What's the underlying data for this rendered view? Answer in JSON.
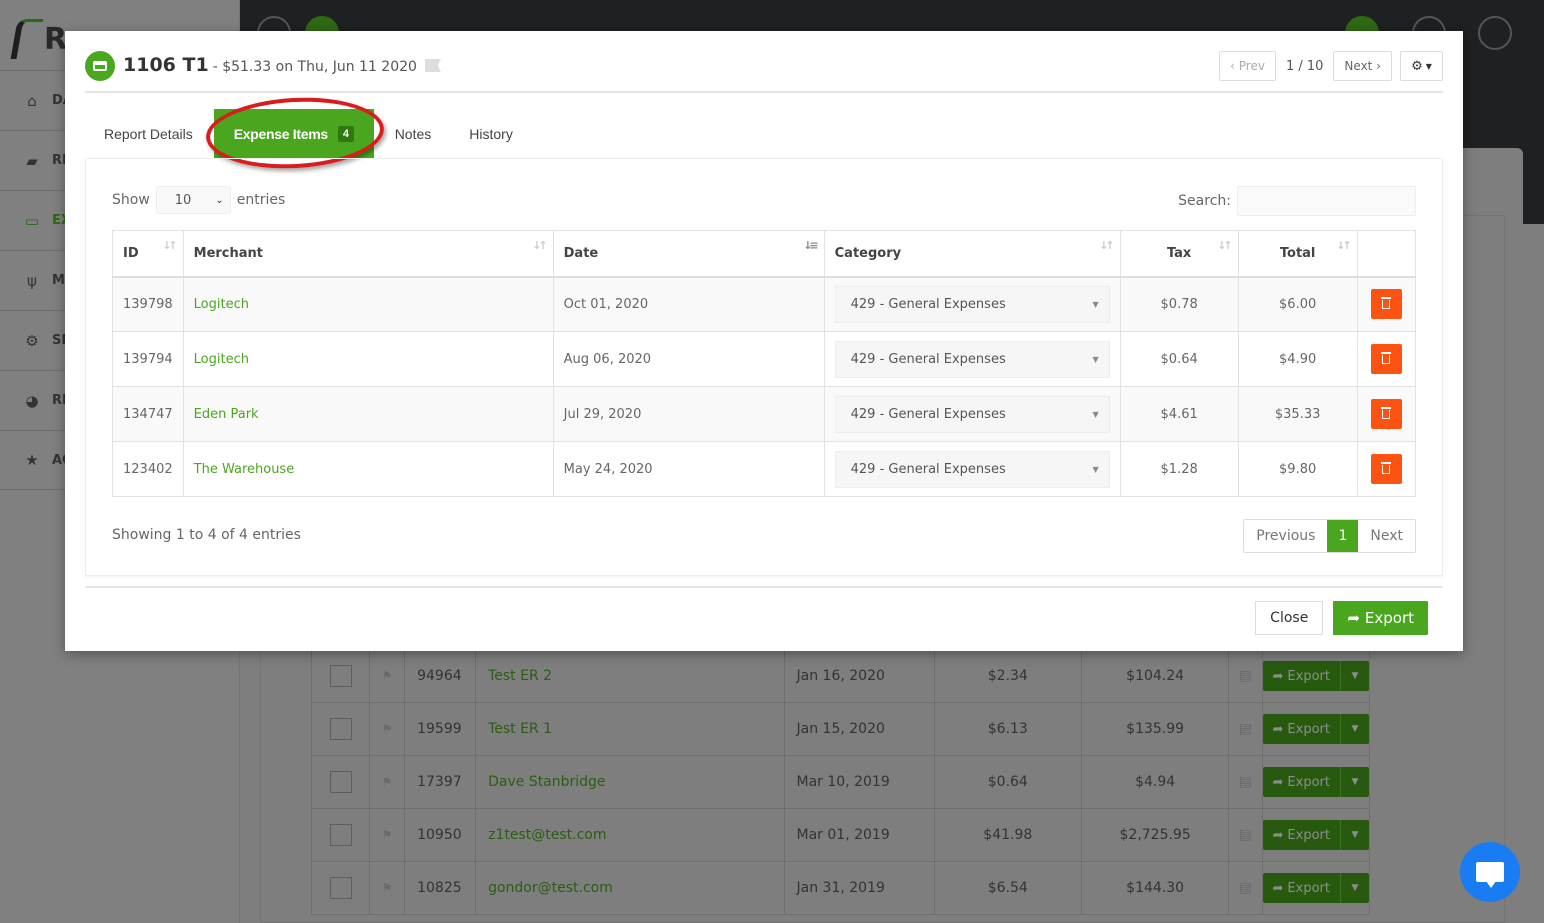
{
  "background": {
    "logo_text": "Re",
    "nav": [
      {
        "label": "DA",
        "icon": "home-icon",
        "glyph": "⌂"
      },
      {
        "label": "RE",
        "icon": "receipt-icon",
        "glyph": "▰"
      },
      {
        "label": "EX",
        "icon": "credit-card-icon",
        "glyph": "▭",
        "active": true
      },
      {
        "label": "MI",
        "icon": "utensils-icon",
        "glyph": "ψ"
      },
      {
        "label": "SE",
        "icon": "gear-icon",
        "glyph": "⚙"
      },
      {
        "label": "RE",
        "icon": "pie-chart-icon",
        "glyph": "◕"
      },
      {
        "label": "AC",
        "icon": "star-icon",
        "glyph": "★"
      }
    ],
    "rows": [
      {
        "id": "94964",
        "name": "Test ER 2",
        "date": "Jan 16, 2020",
        "tax": "$2.34",
        "total": "$104.24",
        "export": "Export"
      },
      {
        "id": "19599",
        "name": "Test ER 1",
        "date": "Jan 15, 2020",
        "tax": "$6.13",
        "total": "$135.99",
        "export": "Export"
      },
      {
        "id": "17397",
        "name": "Dave Stanbridge",
        "date": "Mar 10, 2019",
        "tax": "$0.64",
        "total": "$4.94",
        "export": "Export"
      },
      {
        "id": "10950",
        "name": "z1test@test.com",
        "date": "Mar 01, 2019",
        "tax": "$41.98",
        "total": "$2,725.95",
        "export": "Export"
      },
      {
        "id": "10825",
        "name": "gondor@test.com",
        "date": "Jan 31, 2019",
        "tax": "$6.54",
        "total": "$144.30",
        "export": "Export"
      }
    ]
  },
  "modal": {
    "title": "1106 T1",
    "subtitle": "- $51.33 on Thu, Jun 11 2020",
    "prev_label": "‹ Prev",
    "pager": "1 / 10",
    "next_label": "Next ›",
    "tabs": [
      {
        "label": "Report Details"
      },
      {
        "label": "Expense Items",
        "badge": "4",
        "active": true
      },
      {
        "label": "Notes"
      },
      {
        "label": "History"
      }
    ],
    "length": {
      "show": "Show",
      "value": "10",
      "entries": "entries"
    },
    "search": {
      "label": "Search:",
      "value": ""
    },
    "columns": [
      "ID",
      "Merchant",
      "Date",
      "Category",
      "Tax",
      "Total"
    ],
    "items": [
      {
        "id": "139798",
        "merchant": "Logitech",
        "date": "Oct 01, 2020",
        "category": "429 - General Expenses",
        "tax": "$0.78",
        "total": "$6.00"
      },
      {
        "id": "139794",
        "merchant": "Logitech",
        "date": "Aug 06, 2020",
        "category": "429 - General Expenses",
        "tax": "$0.64",
        "total": "$4.90"
      },
      {
        "id": "134747",
        "merchant": "Eden Park",
        "date": "Jul 29, 2020",
        "category": "429 - General Expenses",
        "tax": "$4.61",
        "total": "$35.33"
      },
      {
        "id": "123402",
        "merchant": "The Warehouse",
        "date": "May 24, 2020",
        "category": "429 - General Expenses",
        "tax": "$1.28",
        "total": "$9.80"
      }
    ],
    "info": "Showing 1 to 4 of 4 entries",
    "pagination": {
      "previous": "Previous",
      "current": "1",
      "next": "Next"
    },
    "close_label": "Close",
    "export_label": "Export"
  },
  "colors": {
    "accent": "#4aa61f",
    "danger": "#fd5312",
    "annotation": "#d91c1c",
    "chat": "#1a7cf3"
  }
}
